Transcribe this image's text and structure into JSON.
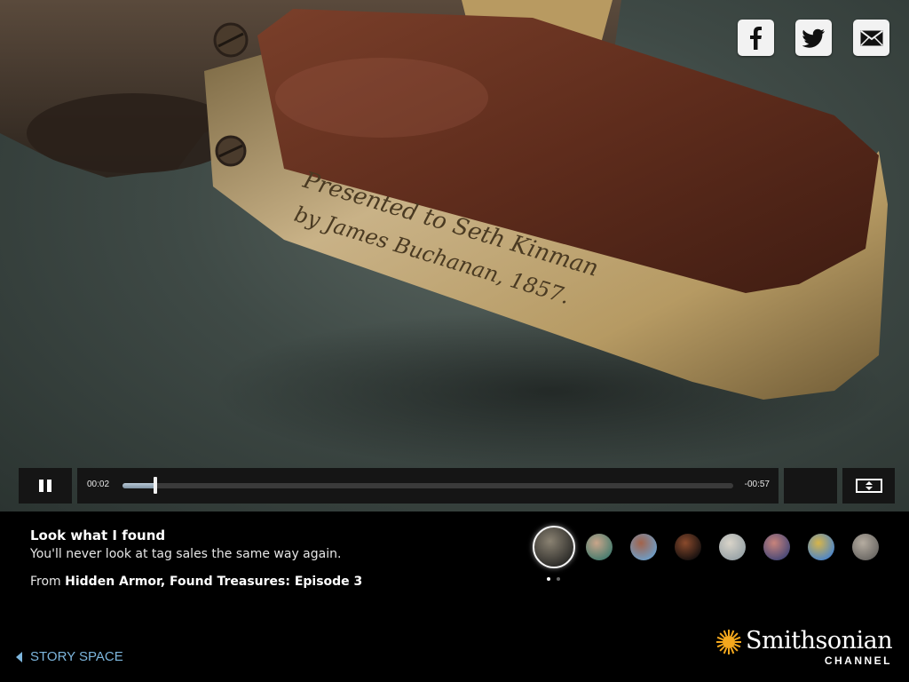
{
  "share": {
    "facebook": "facebook-icon",
    "twitter": "twitter-icon",
    "email": "email-icon"
  },
  "engraving": {
    "line1": "Presented to Seth Kinman",
    "line2": "by James Buchanan, 1857."
  },
  "player": {
    "current_time": "00:02",
    "remaining_time": "-00:57",
    "progress": 0.054,
    "pause_icon": "pause-icon",
    "fullscreen_icon": "fullscreen-icon"
  },
  "info": {
    "title": "Look what I found",
    "subtitle": "You'll never look at tag sales the same way again.",
    "from_prefix": "From",
    "from_show": "Hidden Armor, Found Treasures: Episode 3"
  },
  "thumbnails": [
    {
      "name": "revolver",
      "active": true,
      "colors": [
        "#2e2d2a",
        "#8a8272"
      ]
    },
    {
      "name": "man-portrait",
      "active": false,
      "colors": [
        "#4a7d6f",
        "#c9a58a"
      ]
    },
    {
      "name": "building-sky",
      "active": false,
      "colors": [
        "#6f9cc4",
        "#a3634a"
      ]
    },
    {
      "name": "dark-figures",
      "active": false,
      "colors": [
        "#1a1210",
        "#8a4a2c"
      ]
    },
    {
      "name": "white-monument",
      "active": false,
      "colors": [
        "#9aa4a8",
        "#d9d4c9"
      ]
    },
    {
      "name": "sunset-sky",
      "active": false,
      "colors": [
        "#4b4a78",
        "#c8837b"
      ]
    },
    {
      "name": "yellow-field",
      "active": false,
      "colors": [
        "#4f86c6",
        "#d7b54a"
      ]
    },
    {
      "name": "stone-ruins",
      "active": false,
      "colors": [
        "#6d6a66",
        "#b5aca0"
      ]
    }
  ],
  "pagination": {
    "total": 2,
    "current": 1,
    "active_color": "#ffffff",
    "inactive_color": "#666666"
  },
  "nav": {
    "back_label": "STORY SPACE",
    "back_icon": "chevron-left-icon"
  },
  "brand": {
    "name": "Smithsonian",
    "sub": "CHANNEL",
    "sun_color": "#f4a81d"
  }
}
